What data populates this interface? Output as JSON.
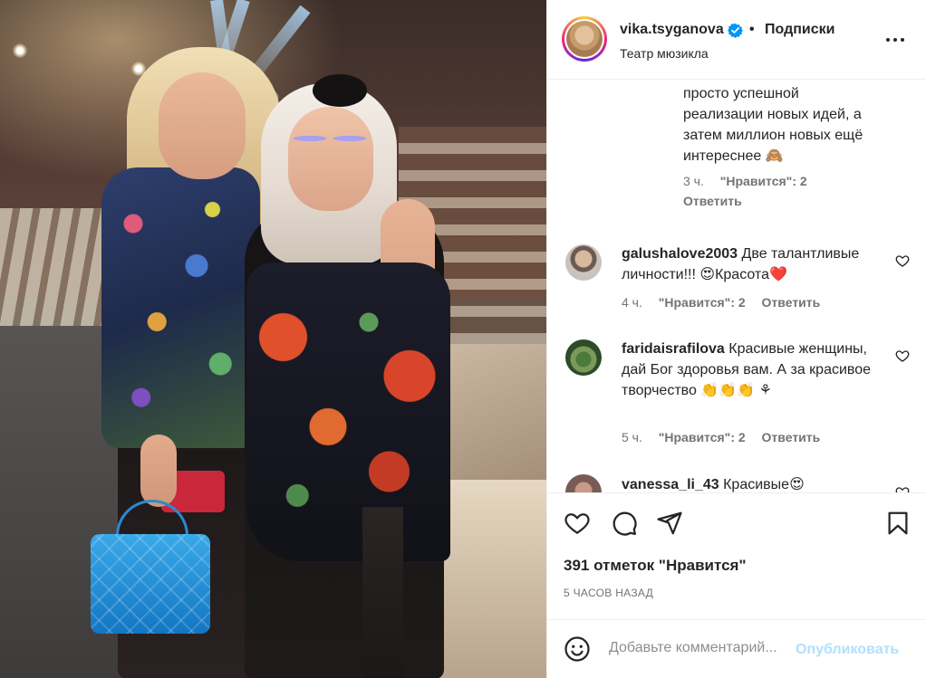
{
  "header": {
    "username": "vika.tsyganova",
    "separator": "•",
    "follow_label": "Подписки",
    "location": "Театр мюзикла"
  },
  "reply": {
    "text_lines": [
      "просто успешной",
      "реализации новых идей, а",
      "затем миллион новых ещё",
      "интереснее 🙈"
    ],
    "time": "3 ч.",
    "likes": "\"Нравится\": 2",
    "reply_label": "Ответить"
  },
  "comments": [
    {
      "username": "galushalove2003",
      "text": "Две талантливые личности!!! 😍Красота❤️",
      "time": "4 ч.",
      "likes": "\"Нравится\": 2",
      "reply_label": "Ответить"
    },
    {
      "username": "faridaisrafilova",
      "text": "Красивые женщины, дай Бог здоровья вам. А за красивое творчество 👏👏👏 ⚘",
      "time": "5 ч.",
      "likes": "\"Нравится\": 2",
      "reply_label": "Ответить"
    },
    {
      "username": "vanessa_li_43",
      "text": "Красивые😍",
      "time": "",
      "likes": "",
      "reply_label": ""
    }
  ],
  "actions": {
    "likes_count": "391 отметок \"Нравится\"",
    "time_ago": "5 ЧАСОВ НАЗАД"
  },
  "add_comment": {
    "placeholder": "Добавьте комментарий...",
    "publish_label": "Опубликовать"
  },
  "colors": {
    "text": "#262626",
    "secondary": "#737373",
    "publish_disabled": "#b2dffc",
    "verified": "#0095f6",
    "border": "#efefef"
  },
  "icons": [
    "verified-badge-icon",
    "more-options-icon",
    "heart-icon",
    "comment-icon",
    "share-icon",
    "bookmark-icon",
    "emoji-icon"
  ]
}
